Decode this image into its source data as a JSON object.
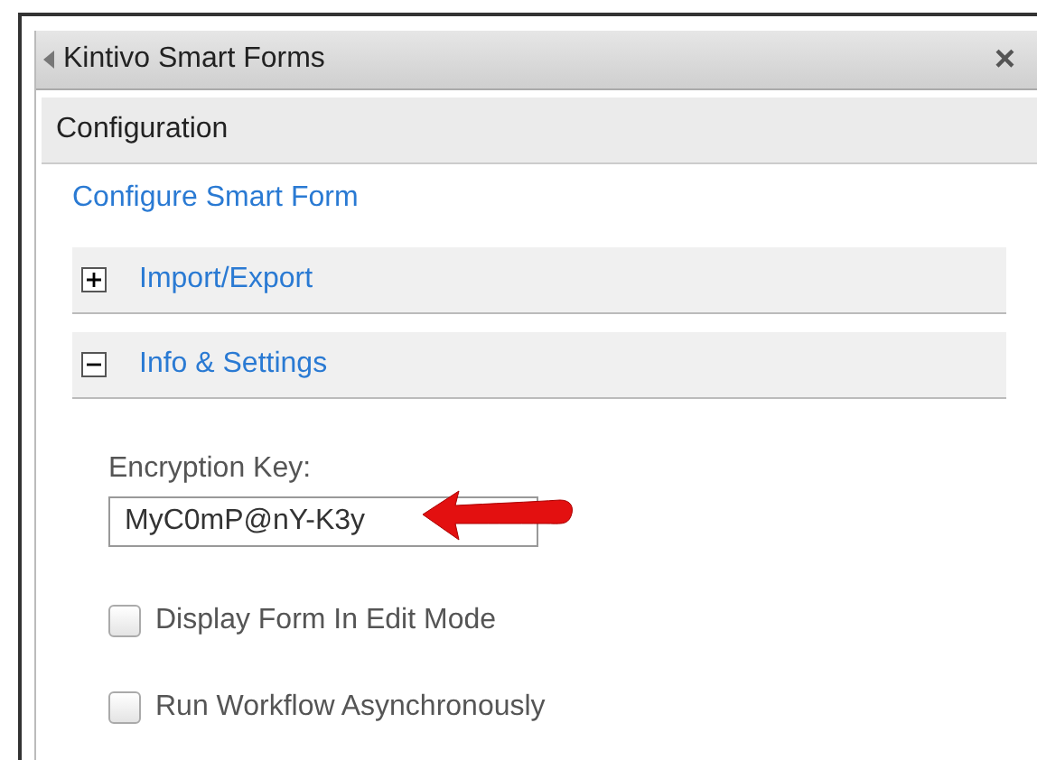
{
  "window": {
    "title": "Kintivo Smart Forms",
    "close": "×"
  },
  "header": "Configuration",
  "link": "Configure Smart Form",
  "sections": [
    {
      "label": "Import/Export",
      "expanded": false
    },
    {
      "label": "Info & Settings",
      "expanded": true
    }
  ],
  "encryption": {
    "label": "Encryption Key:",
    "value": "MyC0mP@nY-K3y"
  },
  "options": [
    {
      "label": "Display Form In Edit Mode",
      "checked": false
    },
    {
      "label": "Run Workflow Asynchronously",
      "checked": false
    }
  ]
}
